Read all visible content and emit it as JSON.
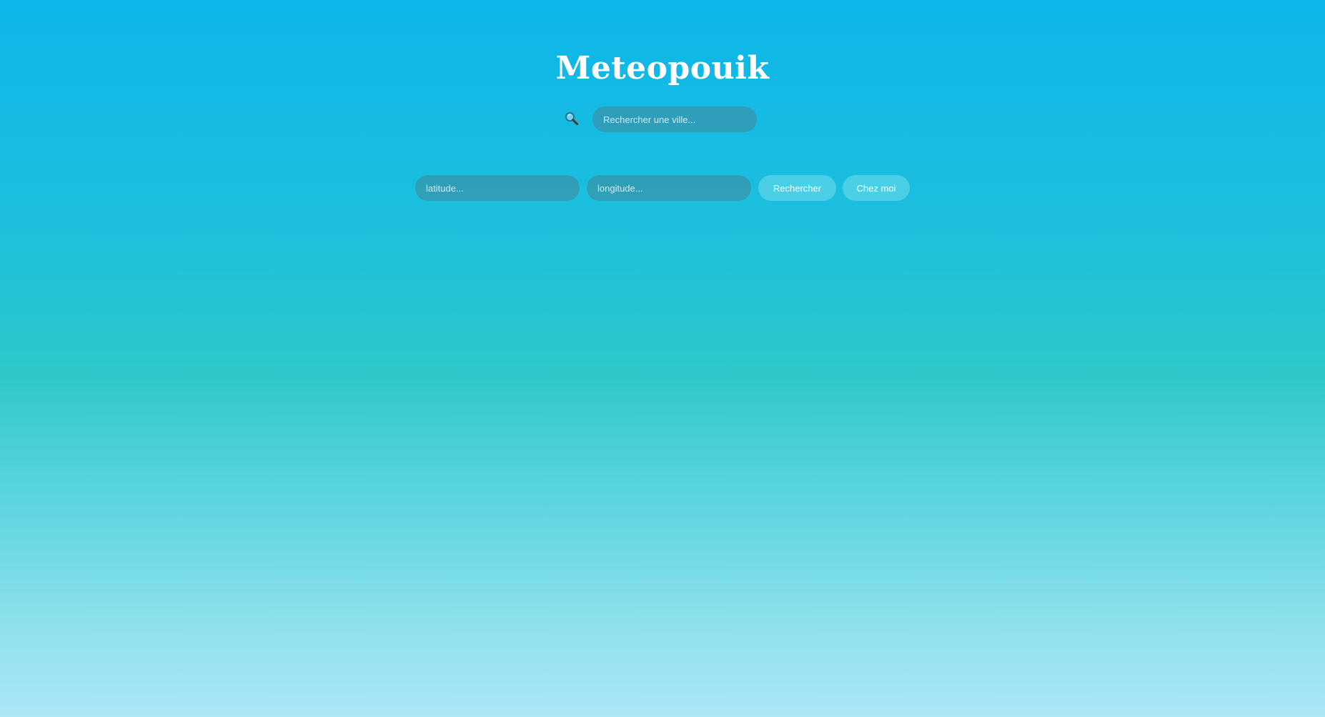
{
  "app": {
    "title": "Meteopouik"
  },
  "city_search": {
    "icon": "magnifying-glass",
    "placeholder": "Rechercher une ville...",
    "value": ""
  },
  "coordinates": {
    "latitude_placeholder": "latitude...",
    "latitude_value": "",
    "longitude_placeholder": "longitude...",
    "longitude_value": "",
    "search_label": "Rechercher",
    "home_label": "Chez moi"
  },
  "colors": {
    "gradient_top": "#0cb6ea",
    "gradient_middle": "#2ec8c9",
    "gradient_bottom": "#ace6f7",
    "text": "#ffffff"
  }
}
